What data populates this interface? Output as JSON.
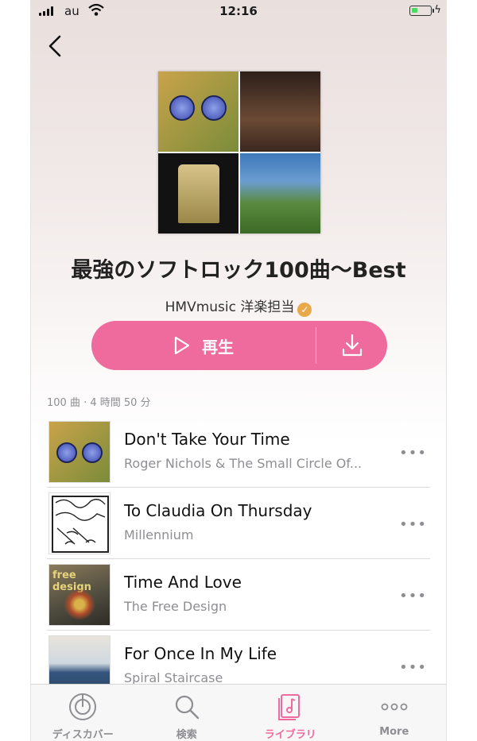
{
  "status_bar": {
    "carrier": "au",
    "time": "12:16",
    "battery_level": 0.35
  },
  "playlist": {
    "title": "最強のソフトロック100曲〜Best",
    "curator": "HMVmusic 洋楽担当",
    "play_label": "再生",
    "meta": "100 曲 · 4 時間 50 分"
  },
  "tracks": [
    {
      "title": "Don't Take Your Time",
      "artist": "Roger Nichols & The Small Circle Of..."
    },
    {
      "title": "To Claudia On Thursday",
      "artist": "Millennium"
    },
    {
      "title": "Time And Love",
      "artist": "The Free Design"
    },
    {
      "title": "For Once In My Life",
      "artist": "Spiral Staircase"
    }
  ],
  "album_art_text": {
    "free_design": "free design"
  },
  "tabs": [
    {
      "label": "ディスカバー",
      "icon": "discover-icon"
    },
    {
      "label": "検索",
      "icon": "search-icon"
    },
    {
      "label": "ライブラリ",
      "icon": "library-icon"
    },
    {
      "label": "More",
      "icon": "more-icon"
    }
  ],
  "colors": {
    "accent": "#ef6a9d",
    "verified": "#e8a94a",
    "secondary_text": "#8e8e93"
  }
}
